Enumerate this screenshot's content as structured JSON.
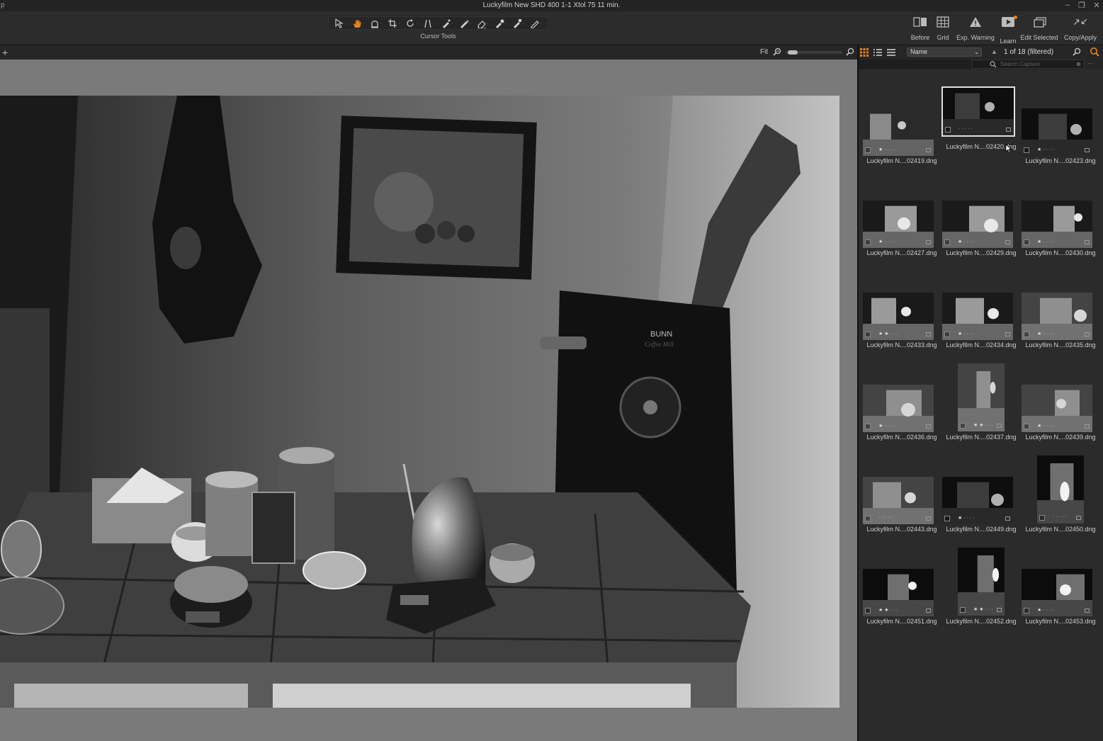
{
  "window": {
    "title": "Luckyfilm New SHD 400 1-1 Xtol 75 11 min.",
    "app_glyph": "p",
    "controls": {
      "minimize": "–",
      "maximize": "❐",
      "close": "✕"
    }
  },
  "toolbar": {
    "cursor_tools_label": "Cursor Tools",
    "cursor_tools": [
      {
        "name": "select-icon",
        "active": false
      },
      {
        "name": "pan-hand-icon",
        "active": true
      },
      {
        "name": "loupe-icon",
        "active": false
      },
      {
        "name": "crop-icon",
        "active": false
      },
      {
        "name": "rotate-icon",
        "active": false
      },
      {
        "name": "keystone-icon",
        "active": false
      },
      {
        "name": "spot-removal-icon",
        "active": false
      },
      {
        "name": "brush-icon",
        "active": false
      },
      {
        "name": "eraser-icon",
        "active": false
      },
      {
        "name": "picker-icon",
        "active": false
      },
      {
        "name": "wb-picker-icon",
        "active": false
      },
      {
        "name": "annotation-icon",
        "active": false
      }
    ],
    "right_tools": [
      {
        "key": "before",
        "label": "Before",
        "icon": "before-after-icon"
      },
      {
        "key": "grid",
        "label": "Grid",
        "icon": "grid-icon"
      },
      {
        "key": "exp",
        "label": "Exp. Warning",
        "icon": "warning-triangle-icon"
      },
      {
        "key": "learn",
        "label": "Learn",
        "icon": "play-video-icon"
      },
      {
        "key": "edit",
        "label": "Edit Selected",
        "icon": "edit-stack-icon"
      },
      {
        "key": "copy",
        "label": "Copy/Apply",
        "icon": "copy-apply-icon"
      }
    ]
  },
  "viewer": {
    "add_label": "+",
    "zoom_label": "Fit",
    "zoom_level": 0.05
  },
  "browser": {
    "sort_field": "Name",
    "sort_chevron": "⌄",
    "sort_direction": "▲",
    "count_label": "1 of 18 (filtered)",
    "search_placeholder": "Search Capture",
    "search_clear": "⊗",
    "search_more": "···",
    "thumbnails": [
      {
        "file": "Luckyfilm N....02419.dng",
        "orientation": "landscape",
        "selected": false,
        "stars": 1,
        "tone": "mid"
      },
      {
        "file": "Luckyfilm N....02420.dng",
        "orientation": "landscape",
        "selected": true,
        "stars": 0,
        "tone": "dark"
      },
      {
        "file": "Luckyfilm N....02423.dng",
        "orientation": "landscape",
        "selected": false,
        "stars": 1,
        "tone": "dark"
      },
      {
        "file": "Luckyfilm N....02427.dng",
        "orientation": "landscape",
        "selected": false,
        "stars": 1,
        "tone": "window"
      },
      {
        "file": "Luckyfilm N....02429.dng",
        "orientation": "landscape",
        "selected": false,
        "stars": 1,
        "tone": "window"
      },
      {
        "file": "Luckyfilm N....02430.dng",
        "orientation": "landscape",
        "selected": false,
        "stars": 1,
        "tone": "window"
      },
      {
        "file": "Luckyfilm N....02433.dng",
        "orientation": "landscape",
        "selected": false,
        "stars": 2,
        "tone": "window"
      },
      {
        "file": "Luckyfilm N....02434.dng",
        "orientation": "landscape",
        "selected": false,
        "stars": 1,
        "tone": "window"
      },
      {
        "file": "Luckyfilm N....02435.dng",
        "orientation": "landscape",
        "selected": false,
        "stars": 1,
        "tone": "yard"
      },
      {
        "file": "Luckyfilm N....02436.dng",
        "orientation": "landscape",
        "selected": false,
        "stars": 1,
        "tone": "yard"
      },
      {
        "file": "Luckyfilm N....02437.dng",
        "orientation": "portrait",
        "selected": false,
        "stars": 2,
        "tone": "yard"
      },
      {
        "file": "Luckyfilm N....02439.dng",
        "orientation": "landscape",
        "selected": false,
        "stars": 1,
        "tone": "yard"
      },
      {
        "file": "Luckyfilm N....02443.dng",
        "orientation": "landscape",
        "selected": false,
        "stars": 0,
        "tone": "yard"
      },
      {
        "file": "Luckyfilm N....02449.dng",
        "orientation": "landscape",
        "selected": false,
        "stars": 1,
        "tone": "dark"
      },
      {
        "file": "Luckyfilm N....02450.dng",
        "orientation": "portrait",
        "selected": false,
        "stars": 0,
        "tone": "trees"
      },
      {
        "file": "Luckyfilm N....02451.dng",
        "orientation": "landscape",
        "selected": false,
        "stars": 2,
        "tone": "trees"
      },
      {
        "file": "Luckyfilm N....02452.dng",
        "orientation": "portrait",
        "selected": false,
        "stars": 2,
        "tone": "trees"
      },
      {
        "file": "Luckyfilm N....02453.dng",
        "orientation": "landscape",
        "selected": false,
        "stars": 1,
        "tone": "trees"
      }
    ]
  },
  "photo": {
    "brand_text": "BUNN",
    "script_text": "Coffee Mill"
  },
  "colors": {
    "accent": "#e8821e",
    "panel": "#2b2b2b",
    "viewer_bg": "#7a7a7a"
  }
}
